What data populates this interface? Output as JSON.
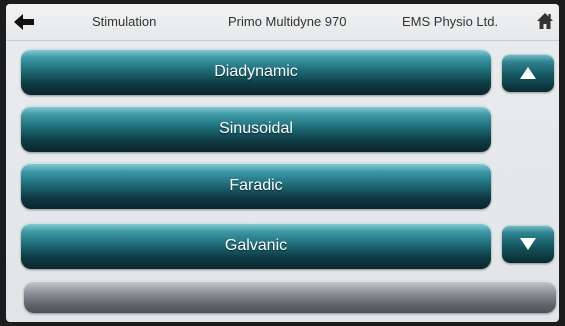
{
  "header": {
    "back_icon": "left-arrow-icon",
    "section": "Stimulation",
    "device": "Primo Multidyne 970",
    "manufacturer": "EMS Physio Ltd.",
    "home_icon": "home-icon"
  },
  "modes": [
    {
      "label": "Diadynamic"
    },
    {
      "label": "Sinusoidal"
    },
    {
      "label": "Faradic"
    },
    {
      "label": "Galvanic"
    },
    {
      "label": ""
    }
  ],
  "scroll": {
    "up_icon": "triangle-up-icon",
    "down_icon": "triangle-down-icon"
  },
  "colors": {
    "button_teal": "#1f6f7b",
    "button_dark": "#0a262d",
    "screen_bg": "#e6e8ea"
  }
}
